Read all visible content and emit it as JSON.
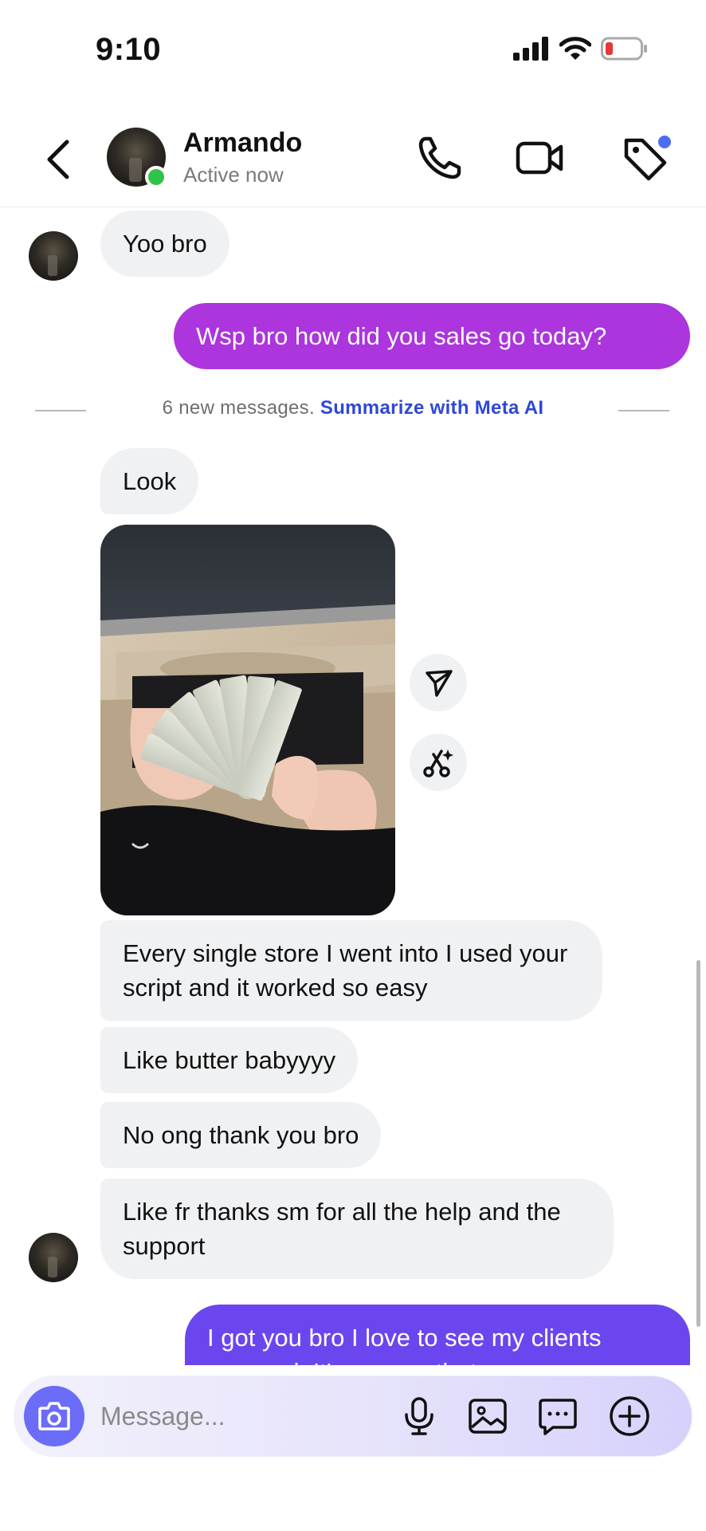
{
  "status_bar": {
    "time": "9:10"
  },
  "header": {
    "contact_name": "Armando",
    "contact_status": "Active now"
  },
  "divider": {
    "new_messages": "6 new messages.",
    "summarize_link": "Summarize with Meta AI"
  },
  "messages": [
    {
      "side": "in",
      "text": "Yoo bro"
    },
    {
      "side": "out",
      "text": "Wsp bro how did you sales go today?"
    },
    {
      "side": "in",
      "text": "Look"
    },
    {
      "side": "in",
      "type": "photo"
    },
    {
      "side": "in",
      "text": "Every single store I went into I used your script and it worked so easy"
    },
    {
      "side": "in",
      "text": "Like butter babyyyy"
    },
    {
      "side": "in",
      "text": "No ong thank you bro"
    },
    {
      "side": "in",
      "text": "Like fr thanks sm for all the help and the support"
    },
    {
      "side": "out",
      "text": "I got you bro I love to see my clients succeed. It's so new that every"
    }
  ],
  "composer": {
    "placeholder": "Message..."
  },
  "icons": {
    "back": "chevron-left-icon",
    "call": "phone-icon",
    "video": "video-camera-icon",
    "tag": "tag-icon",
    "forward": "send-icon",
    "remix": "scissors-sparkle-icon",
    "camera": "camera-icon",
    "mic": "microphone-icon",
    "gallery": "image-icon",
    "sticker": "chat-bubble-icon",
    "add": "plus-circle-icon"
  },
  "colors": {
    "outgoing_first": "#ac35dd",
    "outgoing_last": "#6b46ef",
    "incoming": "#f0f1f3",
    "online": "#31c24a",
    "link": "#2f48d8",
    "battery_low": "#e53935"
  }
}
